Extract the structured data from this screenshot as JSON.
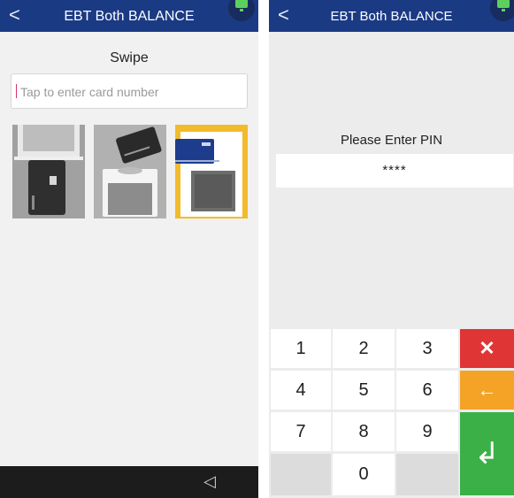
{
  "left_screen": {
    "header": {
      "back_icon": "chevron-left-icon",
      "back_glyph": "<",
      "title": "EBT Both BALANCE"
    },
    "prompt": "Swipe",
    "card_input": {
      "placeholder": "Tap to enter card number",
      "value": ""
    },
    "illustrations": [
      "card-insert-icon",
      "contactless-tap-icon",
      "card-swipe-icon"
    ],
    "nav": {
      "back_glyph": "◁"
    }
  },
  "right_screen": {
    "header": {
      "back_glyph": "<",
      "title": "EBT Both BALANCE"
    },
    "pin_label": "Please Enter PIN",
    "pin_value": "****",
    "keypad": {
      "digits": [
        "1",
        "2",
        "3",
        "4",
        "5",
        "6",
        "7",
        "8",
        "9",
        "0"
      ],
      "cancel_glyph": "✕",
      "backspace_glyph": "←",
      "enter_glyph": "↲"
    }
  },
  "colors": {
    "header": "#1b3a84",
    "cancel": "#e03535",
    "backspace": "#f5a327",
    "enter": "#3bb046",
    "status_badge": "#5cd05c"
  }
}
